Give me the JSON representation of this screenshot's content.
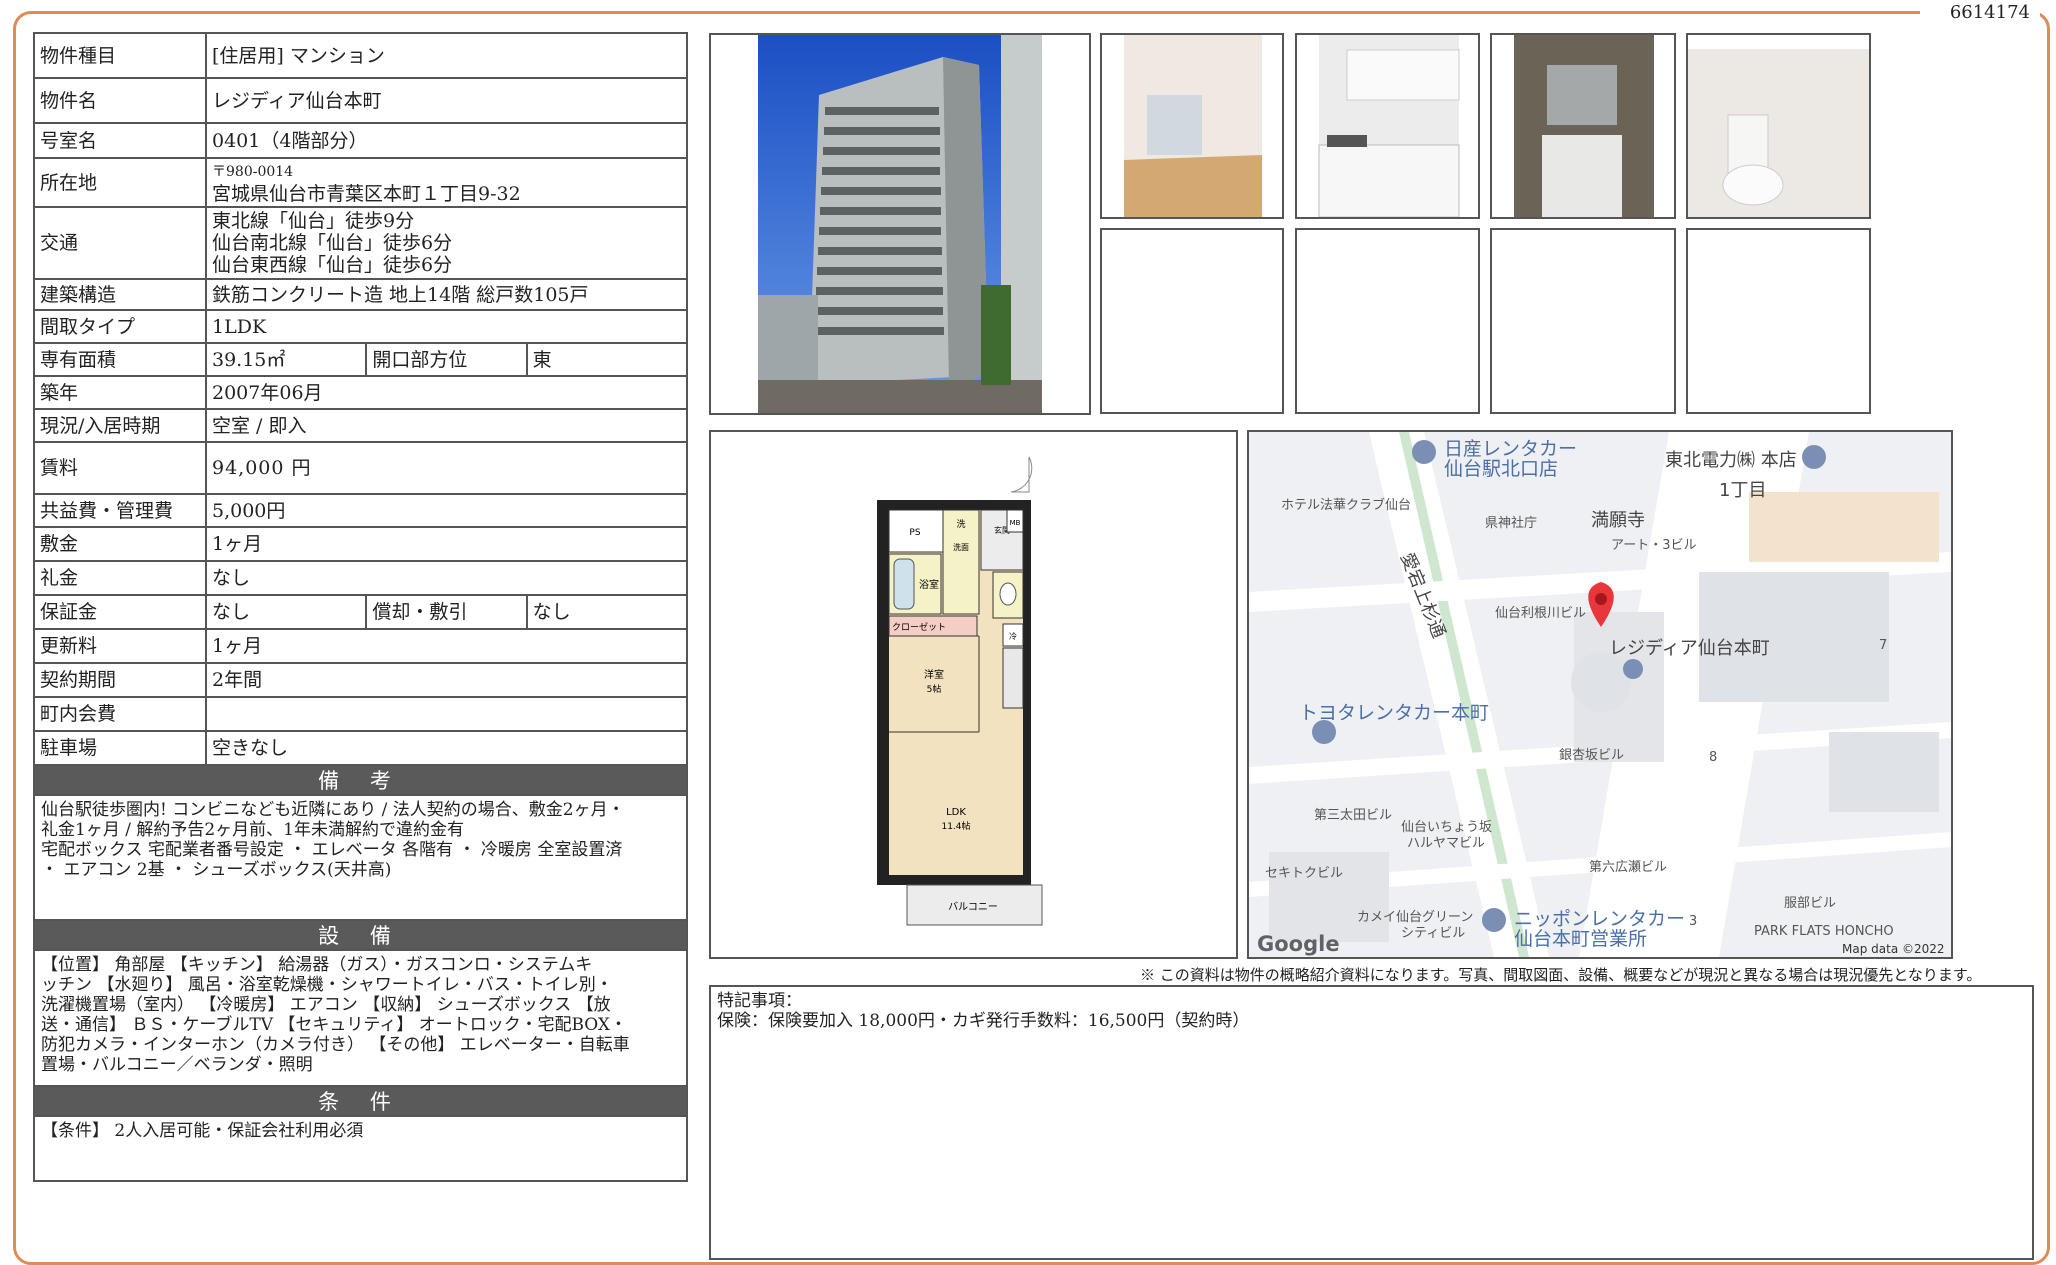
{
  "doc_number": "6614174",
  "spec": {
    "type_label": "物件種目",
    "type_value": "[住居用]  マンション",
    "name_label": "物件名",
    "name_value": "レジディア仙台本町",
    "room_label": "号室名",
    "room_value": "0401（4階部分）",
    "addr_label": "所在地",
    "addr_zip": "〒980-0014",
    "addr_value": "宮城県仙台市青葉区本町１丁目9-32",
    "transit_label": "交通",
    "transit": [
      "東北線「仙台」徒歩9分",
      "仙台南北線「仙台」徒歩6分",
      "仙台東西線「仙台」徒歩6分"
    ],
    "struct_label": "建築構造",
    "struct_value": "鉄筋コンクリート造  地上14階  総戸数105戸",
    "layout_label": "間取タイプ",
    "layout_value": "1LDK",
    "area_label": "専有面積",
    "area_value": "39.15㎡",
    "dir_label": "開口部方位",
    "dir_value": "東",
    "built_label": "築年",
    "built_value": "2007年06月",
    "status_label": "現況/入居時期",
    "status_value": "空室  /  即入",
    "rent_label": "賃料",
    "rent_value": "94,000 円",
    "fee_label": "共益費・管理費",
    "fee_value": "5,000円",
    "deposit_label": "敷金",
    "deposit_value": "1ヶ月",
    "key_label": "礼金",
    "key_value": "なし",
    "guarantee_label": "保証金",
    "guarantee_value": "なし",
    "amort_label": "償却・敷引",
    "amort_value": "なし",
    "renew_label": "更新料",
    "renew_value": "1ヶ月",
    "period_label": "契約期間",
    "period_value": "2年間",
    "town_label": "町内会費",
    "town_value": "",
    "parking_label": "駐車場",
    "parking_value": "空きなし"
  },
  "notes_header": "備 考",
  "notes_lines": [
    "仙台駅徒歩圏内! コンビニなども近隣にあり  /  法人契約の場合、敷金2ヶ月・",
    "礼金1ヶ月  /  解約予告2ヶ月前、1年未満解約で違約金有",
    "宅配ボックス  宅配業者番号設定  ・  エレベータ  各階有  ・  冷暖房  全室設置済",
    "・  エアコン  2基  ・  シューズボックス(天井高)"
  ],
  "equip_header": "設 備",
  "equip_lines": [
    "【位置】  角部屋  【キッチン】  給湯器（ガス）・ガスコンロ・システムキ",
    "ッチン  【水廻り】  風呂・浴室乾燥機・シャワートイレ・バス・トイレ別・",
    "洗濯機置場（室内）  【冷暖房】  エアコン  【収納】  シューズボックス  【放",
    "送・通信】  ＢＳ・ケーブルTV 【セキュリティ】  オートロック・宅配BOX・",
    "防犯カメラ・インターホン（カメラ付き）  【その他】  エレベーター・自転車",
    "置場・バルコニー／ベランダ・照明"
  ],
  "cond_header": "条 件",
  "cond_text": "【条件】  2人入居可能・保証会社利用必須",
  "floorplan": {
    "ps": "PS",
    "wash": "洗",
    "washroom": "洗面",
    "entrance": "玄関",
    "mb": "MB",
    "bath": "浴室",
    "closet": "クローゼット",
    "fridge": "冷",
    "western": "洋室",
    "western_size": "5帖",
    "ldk": "LDK",
    "ldk_size": "11.4帖",
    "balcony": "バルコニー"
  },
  "map": {
    "labels": [
      "日産レンタカー",
      "仙台駅北口店",
      "東北電力㈱ 本店",
      "1丁目",
      "ホテル法華クラブ仙台",
      "満願寺",
      "県神社庁",
      "アート・3ビル",
      "愛宕上杉通",
      "仙台利根川ビル",
      "レジディア仙台本町",
      "7",
      "トヨタレンタカー本町",
      "銀杏坂ビル",
      "8",
      "第三太田ビル",
      "仙台いちょう坂",
      "ハルヤマビル",
      "第六広瀬ビル",
      "セキトクビル",
      "カメイ仙台グリーン",
      "シティビル",
      "ニッポンレンタカー",
      "仙台本町営業所",
      "3",
      "服部ビル",
      "PARK FLATS HONCHO",
      "Google",
      "Map data ©2022"
    ]
  },
  "notice": "※  この資料は物件の概略紹介資料になります。写真、間取図面、設備、概要などが現況と異なる場合は現況優先となります。",
  "remarks_title": "特記事項：",
  "remarks_text": "保険：保険要加入  18,000円・カギ発行手数料：16,500円（契約時）"
}
